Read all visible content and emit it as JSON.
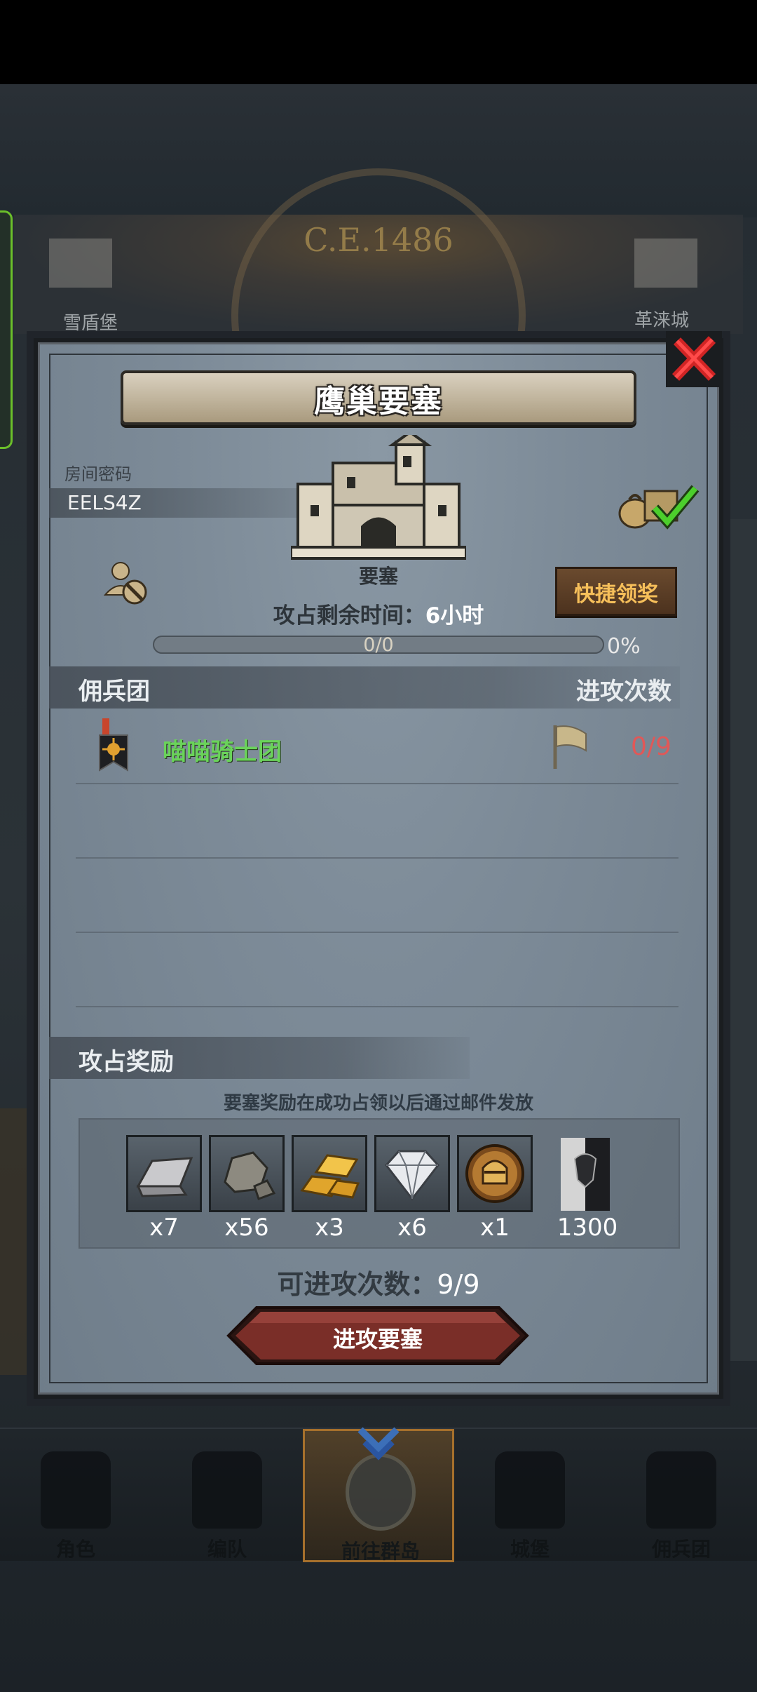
{
  "background": {
    "year": "C.E.1486",
    "city_left": "雪盾堡",
    "city_right": "革涞城"
  },
  "modal": {
    "title": "鹰巢要塞",
    "room_code_label": "房间密码",
    "room_code": "EELS4Z",
    "building_label": "要塞",
    "quick_claim_label": "快捷领奖",
    "time_label": "攻占剩余时间：",
    "time_value": "6小时",
    "progress_count": "0/0",
    "progress_percent": "0%",
    "progress_fraction": 0,
    "legion_header": "佣兵团",
    "attacks_header": "进攻次数",
    "legions": [
      {
        "name": "喵喵骑士团",
        "attacks": "0/9"
      }
    ],
    "rewards_header": "攻占奖励",
    "rewards_note": "要塞奖励在成功占领以后通过邮件发放",
    "rewards": [
      {
        "icon": "silver-ingot-icon",
        "count": "x7"
      },
      {
        "icon": "stone-ore-icon",
        "count": "x56"
      },
      {
        "icon": "gold-bars-icon",
        "count": "x3"
      },
      {
        "icon": "diamond-icon",
        "count": "x6"
      },
      {
        "icon": "knight-medal-icon",
        "count": "x1"
      },
      {
        "icon": "legion-banner-icon",
        "count": "1300"
      }
    ],
    "attacks_left_label": "可进攻次数：",
    "attacks_left_value": "9/9",
    "attack_button_label": "进攻要塞"
  },
  "bottom_nav": [
    {
      "label": "角色",
      "icon": "knight-helmet-icon"
    },
    {
      "label": "编队",
      "icon": "formation-icon"
    },
    {
      "label": "前往群岛",
      "icon": "island-compass-icon",
      "active": true
    },
    {
      "label": "城堡",
      "icon": "castle-icon"
    },
    {
      "label": "佣兵团",
      "icon": "mercenary-ship-icon"
    }
  ],
  "colors": {
    "legion_name": "#6ad35a",
    "attack_count": "#e05858",
    "quick_claim_text": "#f6bf5a",
    "active_nav_border": "#a6702c"
  }
}
